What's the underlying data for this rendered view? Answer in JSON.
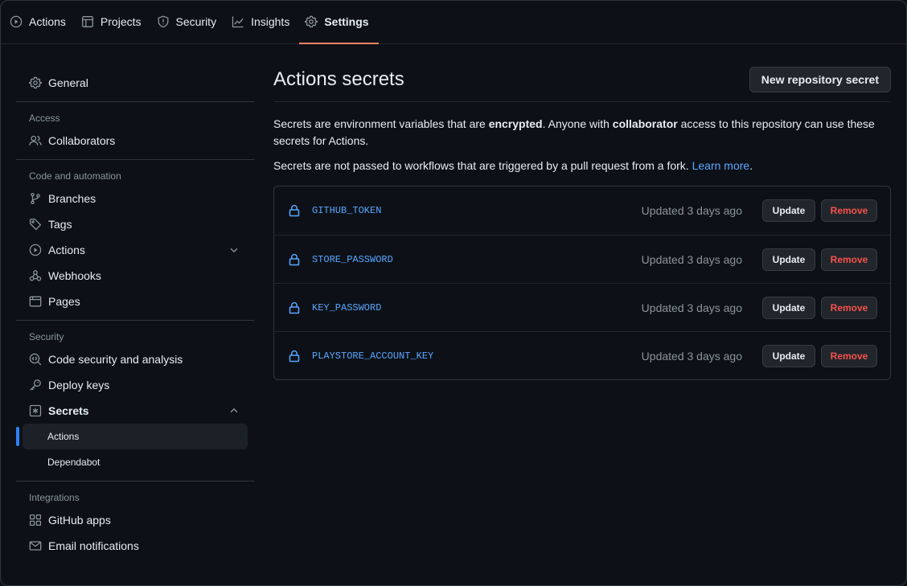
{
  "topnav": {
    "tabs": [
      {
        "label": "Actions",
        "icon": "play-circle-icon"
      },
      {
        "label": "Projects",
        "icon": "table-icon"
      },
      {
        "label": "Security",
        "icon": "shield-icon"
      },
      {
        "label": "Insights",
        "icon": "graph-icon"
      },
      {
        "label": "Settings",
        "icon": "gear-icon",
        "active": true
      }
    ]
  },
  "sidebar": {
    "general": "General",
    "access_heading": "Access",
    "collaborators": "Collaborators",
    "code_heading": "Code and automation",
    "branches": "Branches",
    "tags": "Tags",
    "actions": "Actions",
    "webhooks": "Webhooks",
    "pages": "Pages",
    "security_heading": "Security",
    "code_security": "Code security and analysis",
    "deploy_keys": "Deploy keys",
    "secrets": "Secrets",
    "secrets_actions": "Actions",
    "secrets_dependabot": "Dependabot",
    "integrations_heading": "Integrations",
    "github_apps": "GitHub apps",
    "email_notifications": "Email notifications"
  },
  "main": {
    "title": "Actions secrets",
    "new_button": "New repository secret",
    "desc1_a": "Secrets are environment variables that are ",
    "desc1_b": "encrypted",
    "desc1_c": ". Anyone with ",
    "desc1_d": "collaborator",
    "desc1_e": " access to this repository can use these secrets for Actions.",
    "desc2_a": "Secrets are not passed to workflows that are triggered by a pull request from a fork. ",
    "desc2_link": "Learn more",
    "desc2_b": ".",
    "secrets": [
      {
        "name": "GITHUB_TOKEN",
        "updated": "Updated 3 days ago",
        "update_label": "Update",
        "remove_label": "Remove"
      },
      {
        "name": "STORE_PASSWORD",
        "updated": "Updated 3 days ago",
        "update_label": "Update",
        "remove_label": "Remove"
      },
      {
        "name": "KEY_PASSWORD",
        "updated": "Updated 3 days ago",
        "update_label": "Update",
        "remove_label": "Remove"
      },
      {
        "name": "PLAYSTORE_ACCOUNT_KEY",
        "updated": "Updated 3 days ago",
        "update_label": "Update",
        "remove_label": "Remove"
      }
    ]
  },
  "colors": {
    "background": "#0d1117",
    "accent": "#2f81f7",
    "link": "#58a6ff",
    "danger": "#f85149",
    "tab_underline": "#f78166"
  }
}
